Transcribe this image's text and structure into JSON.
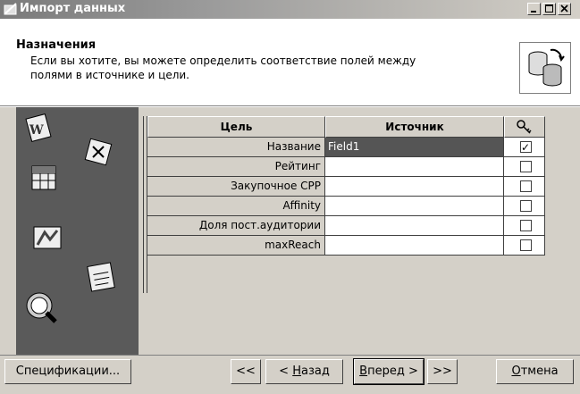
{
  "window": {
    "title": "Импорт данных"
  },
  "header": {
    "title": "Назначения",
    "description": "Если вы хотите, вы можете определить соответствие полей между полями в источнике и цели."
  },
  "grid": {
    "columns": {
      "target": "Цель",
      "source": "Источник",
      "key_icon": "key-icon"
    },
    "rows": [
      {
        "target": "Название",
        "source": "Field1",
        "key": true,
        "selected": true
      },
      {
        "target": "Рейтинг",
        "source": "",
        "key": false
      },
      {
        "target": "Закупочное CPP",
        "source": "",
        "key": false
      },
      {
        "target": "Affinity",
        "source": "",
        "key": false
      },
      {
        "target": "Доля пост.аудитории",
        "source": "",
        "key": false
      },
      {
        "target": "maxReach",
        "source": "",
        "key": false
      }
    ]
  },
  "buttons": {
    "spec": "Спецификации...",
    "first": "<<",
    "back_prefix": "< ",
    "back_ul": "Н",
    "back_rest": "азад",
    "next_ul": "В",
    "next_rest": "перед >",
    "last": ">>",
    "cancel_ul": "О",
    "cancel_rest": "тмена"
  }
}
